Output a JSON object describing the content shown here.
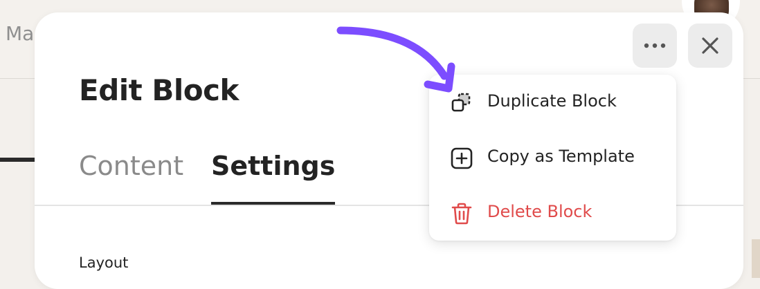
{
  "background": {
    "partial_title": "Ma"
  },
  "modal": {
    "title": "Edit Block",
    "tabs": [
      {
        "label": "Content",
        "active": false
      },
      {
        "label": "Settings",
        "active": true
      }
    ],
    "section_label": "Layout",
    "more_button_icon": "more-horizontal-icon",
    "close_button_icon": "close-icon"
  },
  "menu": {
    "items": [
      {
        "label": "Duplicate Block",
        "icon": "duplicate-icon",
        "danger": false
      },
      {
        "label": "Copy as Template",
        "icon": "plus-square-icon",
        "danger": false
      },
      {
        "label": "Delete Block",
        "icon": "trash-icon",
        "danger": true
      }
    ]
  },
  "colors": {
    "danger": "#e04b4b",
    "annotation_arrow": "#7c4dff",
    "tab_inactive": "#8a8a8a",
    "text": "#232323"
  }
}
